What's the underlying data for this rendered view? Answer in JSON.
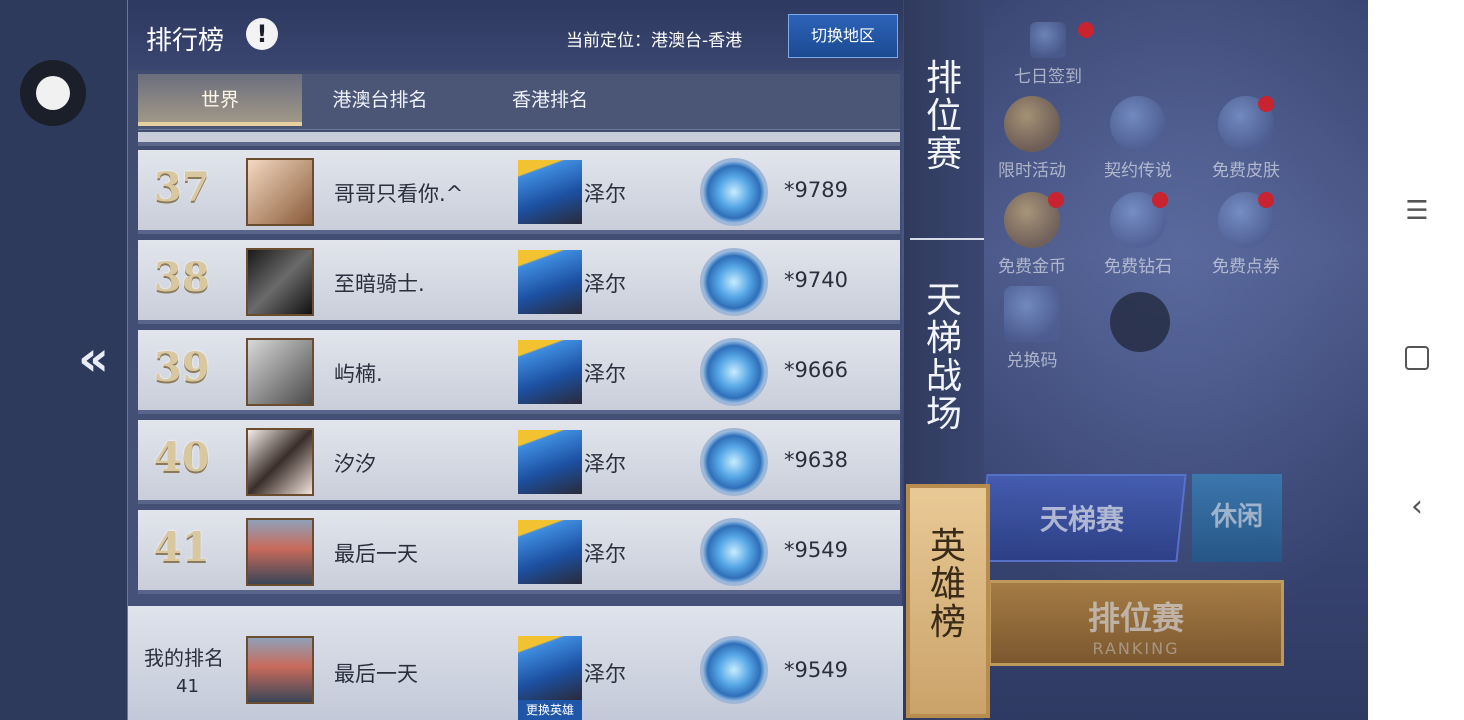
{
  "panel": {
    "title": "排行榜",
    "info_icon": "!",
    "location": "当前定位：港澳台-香港",
    "switch_region": "切换地区"
  },
  "tabs": [
    {
      "label": "世界",
      "active": true
    },
    {
      "label": "港澳台排名",
      "active": false
    },
    {
      "label": "香港排名",
      "active": false
    }
  ],
  "rows": [
    {
      "rank": "37",
      "name": "哥哥只看你.^",
      "hero": "泽尔",
      "score": "*9789"
    },
    {
      "rank": "38",
      "name": "至暗骑士.",
      "hero": "泽尔",
      "score": "*9740"
    },
    {
      "rank": "39",
      "name": "屿楠.",
      "hero": "泽尔",
      "score": "*9666"
    },
    {
      "rank": "40",
      "name": "汐汐",
      "hero": "泽尔",
      "score": "*9638"
    },
    {
      "rank": "41",
      "name": "最后一天",
      "hero": "泽尔",
      "score": "*9549"
    }
  ],
  "my_rank": {
    "label": "我的排名",
    "rank": "41",
    "name": "最后一天",
    "hero": "泽尔",
    "change_hero": "更换英雄",
    "score": "*9549"
  },
  "vertical_tabs": {
    "ranked": "排\n位\n赛",
    "ladder": "天\n梯\n战\n场",
    "heroes": "英\n雄\n榜"
  },
  "background": {
    "icons": [
      {
        "label": "七日签到",
        "icon": "calendar-icon"
      },
      {
        "label": "限时活动",
        "icon": "event-icon"
      },
      {
        "label": "契约传说",
        "icon": "legend-icon"
      },
      {
        "label": "免费皮肤",
        "icon": "skin-icon"
      },
      {
        "label": "免费金币",
        "icon": "coin-icon"
      },
      {
        "label": "免费钻石",
        "icon": "diamond-icon"
      },
      {
        "label": "免费点券",
        "icon": "voucher-icon"
      },
      {
        "label": "兑换码",
        "icon": "redeem-code-icon"
      }
    ],
    "ladder_button": "天梯赛",
    "casual_button": "休闲",
    "ranking_button": "排位赛",
    "ranking_sub": "RANKING"
  },
  "colors": {
    "panel": "#46527a",
    "row": "#d5d9e3",
    "active_tab_gold": "#e6d0a0",
    "switch_button": "#2c63b8",
    "heroes_tab": "#d9b57c"
  }
}
